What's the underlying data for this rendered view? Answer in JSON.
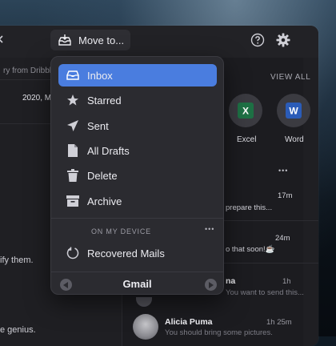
{
  "toolbar": {
    "move_label": "Move to...",
    "icons": [
      "tray-arrow-icon",
      "help-icon",
      "gear-icon"
    ]
  },
  "list_pane": {
    "row_from": "ry from Dribbb",
    "row_date": "2020, M",
    "row_text_1": "ify them.",
    "row_text_2": "e genius."
  },
  "right_pane": {
    "view_all": "VIEW ALL",
    "apps": [
      {
        "label": "Excel",
        "letter": "X",
        "color": "#1e7145"
      },
      {
        "label": "Word",
        "letter": "W",
        "color": "#2b5cb8"
      }
    ],
    "more": "•••",
    "messages": [
      {
        "time": "17m",
        "snippet": "prepare this..."
      },
      {
        "time": "24m",
        "snippet": "o that soon!☕"
      },
      {
        "sender": "na",
        "time": "1h",
        "snippet": "You want to send this..."
      },
      {
        "sender": "Alicia Puma",
        "time": "1h 25m",
        "snippet": "You should bring some pictures."
      }
    ]
  },
  "menu": {
    "items": [
      {
        "label": "Inbox",
        "icon": "inbox-icon",
        "selected": true
      },
      {
        "label": "Starred",
        "icon": "star-icon"
      },
      {
        "label": "Sent",
        "icon": "paper-plane-icon"
      },
      {
        "label": "All Drafts",
        "icon": "document-icon"
      },
      {
        "label": "Delete",
        "icon": "trash-icon"
      },
      {
        "label": "Archive",
        "icon": "archive-box-icon"
      }
    ],
    "section_title": "ON MY DEVICE",
    "section_more": "•••",
    "device_items": [
      {
        "label": "Recovered Mails",
        "icon": "recovery-circle-icon"
      }
    ],
    "account": "Gmail"
  },
  "colors": {
    "accent": "#4a7ddf",
    "menu_bg": "#2b2b30",
    "window_bg": "#1f1f23"
  }
}
